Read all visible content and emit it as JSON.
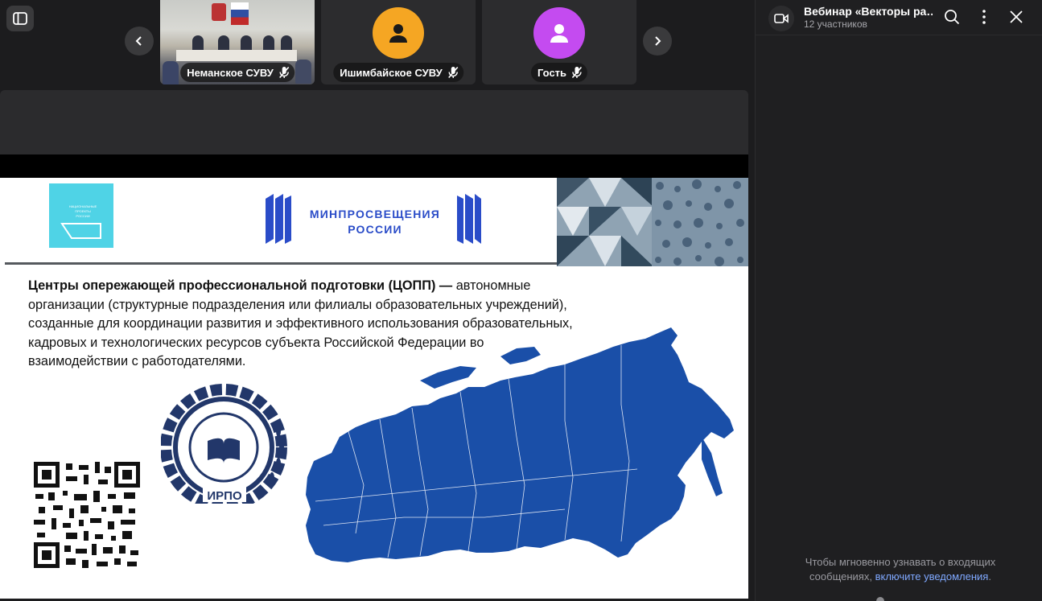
{
  "participants": [
    {
      "name": "Неманское СУВУ",
      "type": "camera",
      "mic": "muted"
    },
    {
      "name": "Ишимбайское СУВУ",
      "type": "avatar",
      "avatar_color": "#f5a623",
      "mic": "muted"
    },
    {
      "name": "Гость",
      "type": "avatar",
      "avatar_color": "#c44bf0",
      "mic": "muted"
    }
  ],
  "slide": {
    "ministry_line1": "МИНПРОСВЕЩЕНИЯ",
    "ministry_line2": "РОССИИ",
    "definition_bold": "Центры опережающей профессиональной подготовки (ЦОПП) —",
    "definition_rest": " автономные организации (структурные подразделения или филиалы образовательных учреждений), созданные для координации развития и эффективного использования образовательных, кадровых и технологических ресурсов субъекта Российской Федерации во взаимодействии с работодателями.",
    "irpo_abbr": "ИРПО",
    "irpo_ring": "ИНСТИТУТ РАЗВИТИЯ ПРОФЕССИОНАЛЬНОГО ОБРАЗОВАНИЯ",
    "logo_left_text": "НАЦИОНАЛЬНЫЕ ПРОЕКТЫ РОССИИ"
  },
  "chat": {
    "title": "Вебинар «Векторы ра…",
    "subtitle": "12 участников",
    "notice_text": "Чтобы мгновенно узнавать о входящих сообщениях,",
    "notice_link": "включите уведомления",
    "notice_end": "."
  },
  "colors": {
    "slide_blue": "#2a4cc8",
    "map_blue": "#1a4fa8",
    "link": "#7fa8ff"
  }
}
